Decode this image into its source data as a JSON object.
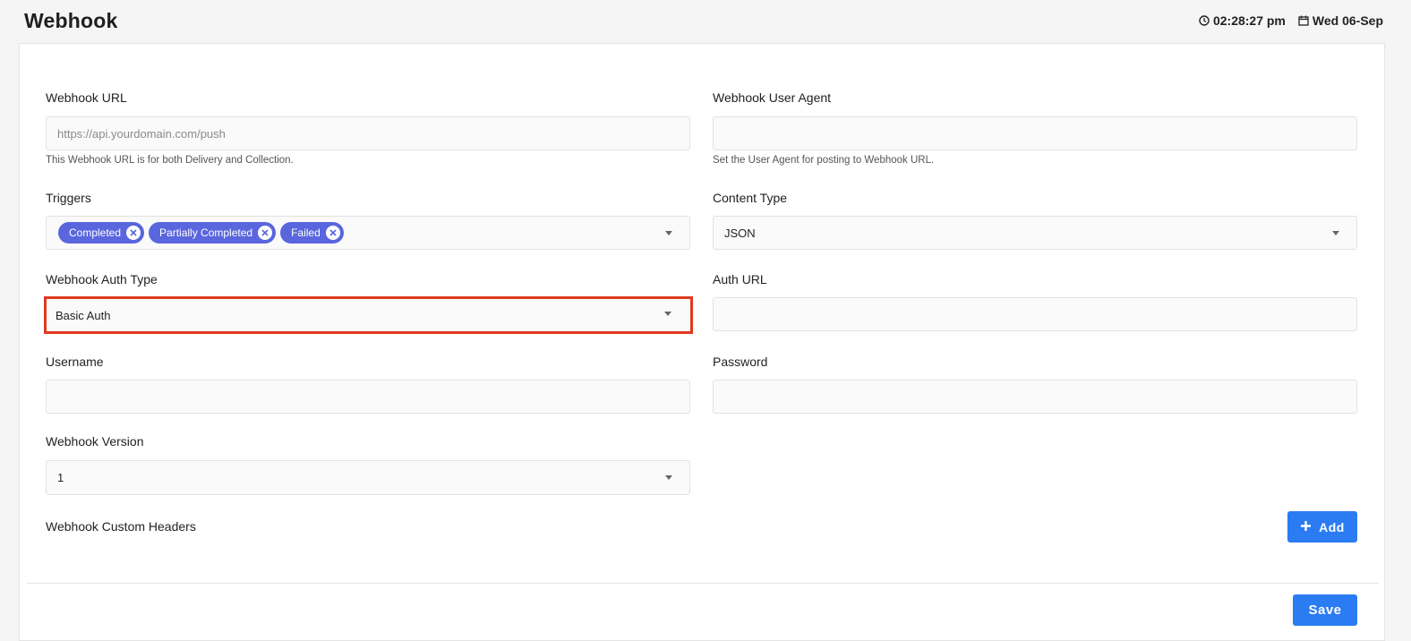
{
  "header": {
    "title": "Webhook",
    "time": "02:28:27 pm",
    "date": "Wed 06-Sep"
  },
  "form": {
    "webhook_url": {
      "label": "Webhook URL",
      "value": "",
      "placeholder": "https://api.yourdomain.com/push",
      "help": "This Webhook URL is for both Delivery and Collection."
    },
    "user_agent": {
      "label": "Webhook User Agent",
      "value": "",
      "help": "Set the User Agent for posting to Webhook URL."
    },
    "triggers": {
      "label": "Triggers",
      "selected": [
        "Completed",
        "Partially Completed",
        "Failed"
      ]
    },
    "content_type": {
      "label": "Content Type",
      "value": "JSON"
    },
    "auth_type": {
      "label": "Webhook Auth Type",
      "value": "Basic Auth"
    },
    "auth_url": {
      "label": "Auth URL",
      "value": ""
    },
    "username": {
      "label": "Username",
      "value": ""
    },
    "password": {
      "label": "Password",
      "value": ""
    },
    "version": {
      "label": "Webhook Version",
      "value": "1"
    },
    "custom_headers": {
      "label": "Webhook Custom Headers",
      "add_label": "Add"
    },
    "save_label": "Save"
  },
  "colors": {
    "accent": "#2b7cf2",
    "tag": "#5a66dd",
    "highlight": "#e03a1e"
  }
}
